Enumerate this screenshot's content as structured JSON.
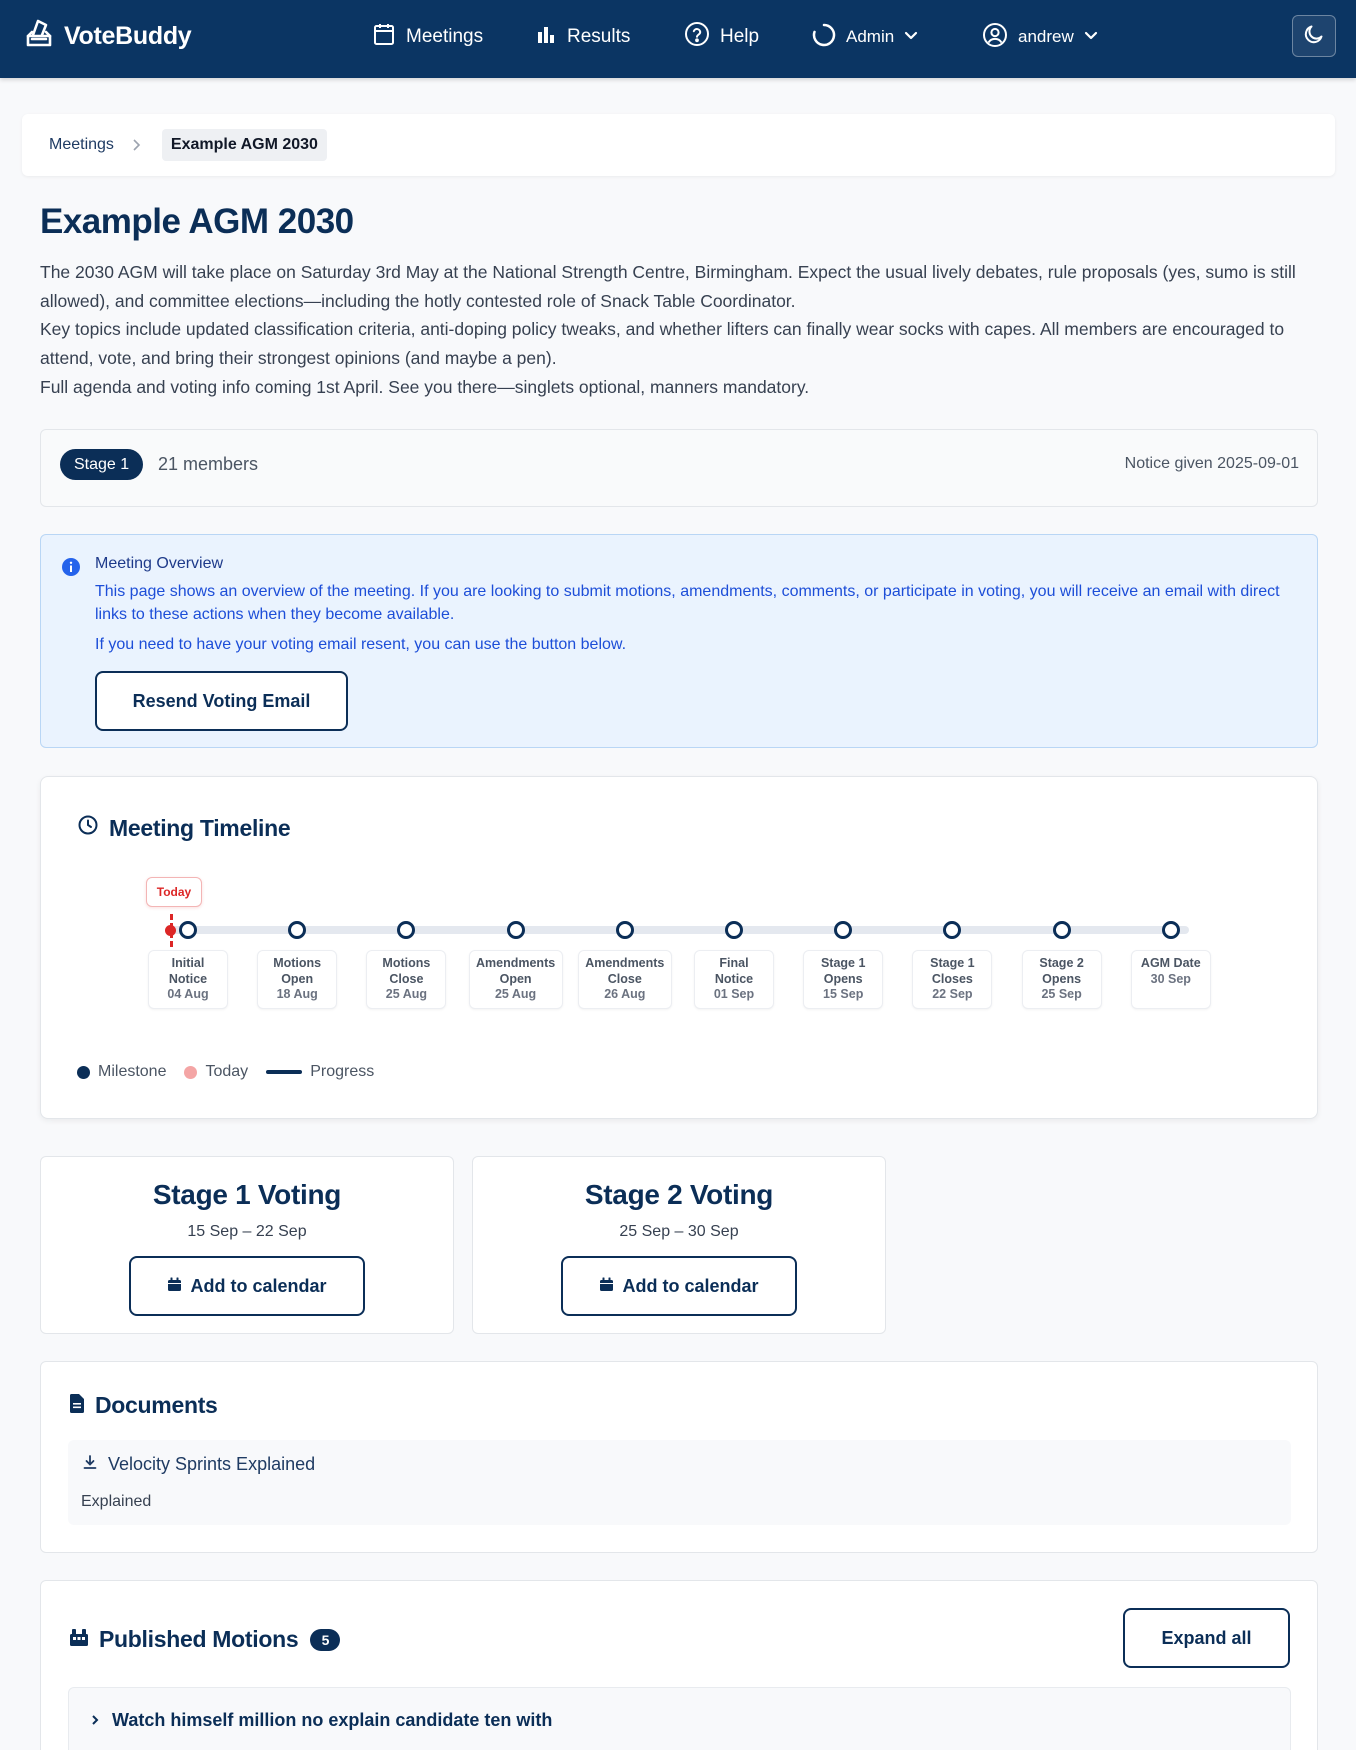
{
  "navbar": {
    "brand": "VoteBuddy",
    "meetings": "Meetings",
    "results": "Results",
    "help": "Help",
    "admin": "Admin",
    "user": "andrew"
  },
  "breadcrumb": {
    "root": "Meetings",
    "current": "Example AGM 2030"
  },
  "meeting": {
    "title": "Example AGM 2030",
    "description": [
      "The 2030 AGM will take place on Saturday 3rd May at the National Strength Centre, Birmingham. Expect the usual lively debates, rule proposals (yes, sumo is still allowed), and committee elections—including the hotly contested role of Snack Table Coordinator.",
      "Key topics include updated classification criteria, anti-doping policy tweaks, and whether lifters can finally wear socks with capes. All members are encouraged to attend, vote, and bring their strongest opinions (and maybe a pen).",
      "Full agenda and voting info coming 1st April. See you there—singlets optional, manners mandatory."
    ],
    "stage": "Stage 1",
    "members": "21 members",
    "notice": "Notice given 2025-09-01"
  },
  "info": {
    "title": "Meeting Overview",
    "text": "This page shows an overview of the meeting. If you are looking to submit motions, amendments, comments, or participate in voting, you will receive an email with direct links to these actions when they become available.",
    "text2": "If you need to have your voting email resent, you can use the button below.",
    "button": "Resend Voting Email"
  },
  "timeline": {
    "heading": "Meeting Timeline",
    "today_label": "Today",
    "milestones": [
      {
        "name": "Initial Notice",
        "date": "04 Aug"
      },
      {
        "name": "Motions Open",
        "date": "18 Aug"
      },
      {
        "name": "Motions Close",
        "date": "25 Aug"
      },
      {
        "name": "Amendments Open",
        "date": "25 Aug"
      },
      {
        "name": "Amendments Close",
        "date": "26 Aug"
      },
      {
        "name": "Final Notice",
        "date": "01 Sep"
      },
      {
        "name": "Stage 1 Opens",
        "date": "15 Sep"
      },
      {
        "name": "Stage 1 Closes",
        "date": "22 Sep"
      },
      {
        "name": "Stage 2 Opens",
        "date": "25 Sep"
      },
      {
        "name": "AGM Date",
        "date": "30 Sep"
      }
    ],
    "legend": {
      "milestone": "Milestone",
      "today": "Today",
      "progress": "Progress"
    },
    "colors": {
      "milestone": "#0b2e57",
      "today": "#f4a5a5",
      "progress": "#0b2e57"
    }
  },
  "voting": [
    {
      "title": "Stage 1 Voting",
      "dates": "15 Sep – 22 Sep",
      "button": "Add to calendar"
    },
    {
      "title": "Stage 2 Voting",
      "dates": "25 Sep – 30 Sep",
      "button": "Add to calendar"
    }
  ],
  "documents": {
    "heading": "Documents",
    "items": [
      {
        "title": "Velocity Sprints Explained",
        "description": "Explained"
      }
    ]
  },
  "motions": {
    "heading": "Published Motions",
    "count": "5",
    "expand": "Expand all",
    "items": [
      {
        "title": "Watch himself million no explain candidate ten with"
      }
    ]
  }
}
